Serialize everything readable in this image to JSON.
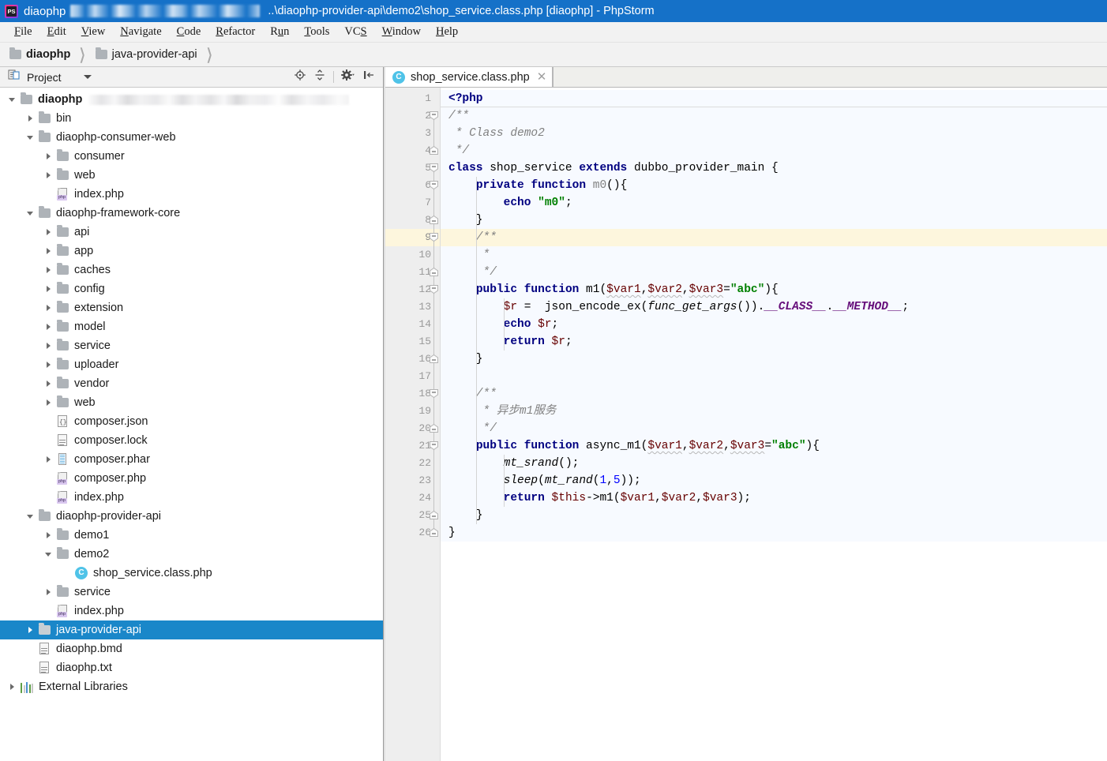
{
  "window": {
    "app_name": "PhpStorm",
    "project_name": "diaophp",
    "title_path": "..\\diaophp-provider-api\\demo2\\shop_service.class.php [diaophp] - PhpStorm",
    "titlebar_color": "#1571c8",
    "app_icon": "phpstorm-icon"
  },
  "menubar": {
    "items": [
      {
        "label": "File",
        "mnemonic": "F"
      },
      {
        "label": "Edit",
        "mnemonic": "E"
      },
      {
        "label": "View",
        "mnemonic": "V"
      },
      {
        "label": "Navigate",
        "mnemonic": "N"
      },
      {
        "label": "Code",
        "mnemonic": "C"
      },
      {
        "label": "Refactor",
        "mnemonic": "R"
      },
      {
        "label": "Run",
        "mnemonic": "u"
      },
      {
        "label": "Tools",
        "mnemonic": "T"
      },
      {
        "label": "VCS",
        "mnemonic": "S"
      },
      {
        "label": "Window",
        "mnemonic": "W"
      },
      {
        "label": "Help",
        "mnemonic": "H"
      }
    ]
  },
  "breadcrumb": {
    "items": [
      {
        "label": "diaophp",
        "icon": "folder-icon",
        "bold": true
      },
      {
        "label": "java-provider-api",
        "icon": "folder-icon",
        "bold": false
      }
    ]
  },
  "project_panel": {
    "title": "Project",
    "dropdown_icon": "chevron-down-icon",
    "toolbar": [
      {
        "name": "locate-icon",
        "title": "Select Opened File"
      },
      {
        "name": "collapse-all-icon",
        "title": "Collapse All"
      },
      {
        "name": "gear-icon",
        "title": "Settings"
      },
      {
        "name": "hide-panel-icon",
        "title": "Hide"
      }
    ],
    "selection_color": "#1a87c9",
    "tree": [
      {
        "label": "diaophp",
        "depth": 0,
        "icon": "folder-icon",
        "arrow": "open",
        "bold": true,
        "blurred_suffix": true
      },
      {
        "label": "bin",
        "depth": 1,
        "icon": "folder-icon",
        "arrow": "closed"
      },
      {
        "label": "diaophp-consumer-web",
        "depth": 1,
        "icon": "folder-icon",
        "arrow": "open"
      },
      {
        "label": "consumer",
        "depth": 2,
        "icon": "folder-icon",
        "arrow": "closed"
      },
      {
        "label": "web",
        "depth": 2,
        "icon": "folder-icon",
        "arrow": "closed"
      },
      {
        "label": "index.php",
        "depth": 2,
        "icon": "php-file-icon",
        "arrow": "none"
      },
      {
        "label": "diaophp-framework-core",
        "depth": 1,
        "icon": "folder-icon",
        "arrow": "open"
      },
      {
        "label": "api",
        "depth": 2,
        "icon": "folder-icon",
        "arrow": "closed"
      },
      {
        "label": "app",
        "depth": 2,
        "icon": "folder-icon",
        "arrow": "closed"
      },
      {
        "label": "caches",
        "depth": 2,
        "icon": "folder-icon",
        "arrow": "closed"
      },
      {
        "label": "config",
        "depth": 2,
        "icon": "folder-icon",
        "arrow": "closed"
      },
      {
        "label": "extension",
        "depth": 2,
        "icon": "folder-icon",
        "arrow": "closed"
      },
      {
        "label": "model",
        "depth": 2,
        "icon": "folder-icon",
        "arrow": "closed"
      },
      {
        "label": "service",
        "depth": 2,
        "icon": "folder-icon",
        "arrow": "closed"
      },
      {
        "label": "uploader",
        "depth": 2,
        "icon": "folder-icon",
        "arrow": "closed"
      },
      {
        "label": "vendor",
        "depth": 2,
        "icon": "folder-icon",
        "arrow": "closed"
      },
      {
        "label": "web",
        "depth": 2,
        "icon": "folder-icon",
        "arrow": "closed"
      },
      {
        "label": "composer.json",
        "depth": 2,
        "icon": "json-file-icon",
        "arrow": "none"
      },
      {
        "label": "composer.lock",
        "depth": 2,
        "icon": "text-file-icon",
        "arrow": "none"
      },
      {
        "label": "composer.phar",
        "depth": 2,
        "icon": "phar-file-icon",
        "arrow": "closed"
      },
      {
        "label": "composer.php",
        "depth": 2,
        "icon": "php-file-icon",
        "arrow": "none"
      },
      {
        "label": "index.php",
        "depth": 2,
        "icon": "php-file-icon",
        "arrow": "none"
      },
      {
        "label": "diaophp-provider-api",
        "depth": 1,
        "icon": "folder-icon",
        "arrow": "open"
      },
      {
        "label": "demo1",
        "depth": 2,
        "icon": "folder-icon",
        "arrow": "closed"
      },
      {
        "label": "demo2",
        "depth": 2,
        "icon": "folder-icon",
        "arrow": "open"
      },
      {
        "label": "shop_service.class.php",
        "depth": 3,
        "icon": "php-class-icon",
        "arrow": "none"
      },
      {
        "label": "service",
        "depth": 2,
        "icon": "folder-icon",
        "arrow": "closed"
      },
      {
        "label": "index.php",
        "depth": 2,
        "icon": "php-file-icon",
        "arrow": "none"
      },
      {
        "label": "java-provider-api",
        "depth": 1,
        "icon": "folder-icon",
        "arrow": "closed",
        "selected": true
      },
      {
        "label": "diaophp.bmd",
        "depth": 1,
        "icon": "text-file-icon",
        "arrow": "none"
      },
      {
        "label": "diaophp.txt",
        "depth": 1,
        "icon": "text-file-icon",
        "arrow": "none"
      },
      {
        "label": "External Libraries",
        "depth": 0,
        "icon": "library-icon",
        "arrow": "closed"
      }
    ]
  },
  "editor": {
    "tabs": [
      {
        "label": "shop_service.class.php",
        "icon": "php-class-icon",
        "active": true,
        "close_icon": "close-icon"
      }
    ],
    "current_line": 9,
    "total_lines": 26,
    "fold_markers": [
      {
        "line": 2,
        "type": "minus-top"
      },
      {
        "line": 4,
        "type": "minus-bottom"
      },
      {
        "line": 5,
        "type": "minus-top"
      },
      {
        "line": 6,
        "type": "minus-top"
      },
      {
        "line": 8,
        "type": "minus-bottom"
      },
      {
        "line": 9,
        "type": "minus-top"
      },
      {
        "line": 11,
        "type": "minus-bottom"
      },
      {
        "line": 12,
        "type": "minus-top"
      },
      {
        "line": 16,
        "type": "minus-bottom"
      },
      {
        "line": 18,
        "type": "minus-top"
      },
      {
        "line": 20,
        "type": "minus-bottom"
      },
      {
        "line": 21,
        "type": "minus-top"
      },
      {
        "line": 25,
        "type": "minus-bottom"
      },
      {
        "line": 26,
        "type": "minus-bottom"
      }
    ],
    "lines": [
      {
        "n": 1,
        "text": "<?php"
      },
      {
        "n": 2,
        "text": "/**"
      },
      {
        "n": 3,
        "text": " * Class demo2"
      },
      {
        "n": 4,
        "text": " */"
      },
      {
        "n": 5,
        "text": "class shop_service extends dubbo_provider_main {"
      },
      {
        "n": 6,
        "text": "    private function m0(){"
      },
      {
        "n": 7,
        "text": "        echo \"m0\";"
      },
      {
        "n": 8,
        "text": "    }"
      },
      {
        "n": 9,
        "text": "    /**"
      },
      {
        "n": 10,
        "text": "     *"
      },
      {
        "n": 11,
        "text": "     */"
      },
      {
        "n": 12,
        "text": "    public function m1($var1,$var2,$var3=\"abc\"){"
      },
      {
        "n": 13,
        "text": "        $r =  json_encode_ex(func_get_args()).__CLASS__.__METHOD__;"
      },
      {
        "n": 14,
        "text": "        echo $r;"
      },
      {
        "n": 15,
        "text": "        return $r;"
      },
      {
        "n": 16,
        "text": "    }"
      },
      {
        "n": 17,
        "text": ""
      },
      {
        "n": 18,
        "text": "    /**"
      },
      {
        "n": 19,
        "text": "     * 异步m1服务"
      },
      {
        "n": 20,
        "text": "     */"
      },
      {
        "n": 21,
        "text": "    public function async_m1($var1,$var2,$var3=\"abc\"){"
      },
      {
        "n": 22,
        "text": "        mt_srand();"
      },
      {
        "n": 23,
        "text": "        sleep(mt_rand(1,5));"
      },
      {
        "n": 24,
        "text": "        return $this->m1($var1,$var2,$var3);"
      },
      {
        "n": 25,
        "text": "    }"
      },
      {
        "n": 26,
        "text": "}"
      }
    ],
    "colors": {
      "keyword": "#000080",
      "comment": "#808080",
      "string": "#008000",
      "variable": "#660000",
      "magic_constant": "#660e7a",
      "number": "#0000ff",
      "background": "#f7faff",
      "current_line_bg": "#fdf6dd",
      "gutter_bg": "#eeeeee"
    }
  }
}
